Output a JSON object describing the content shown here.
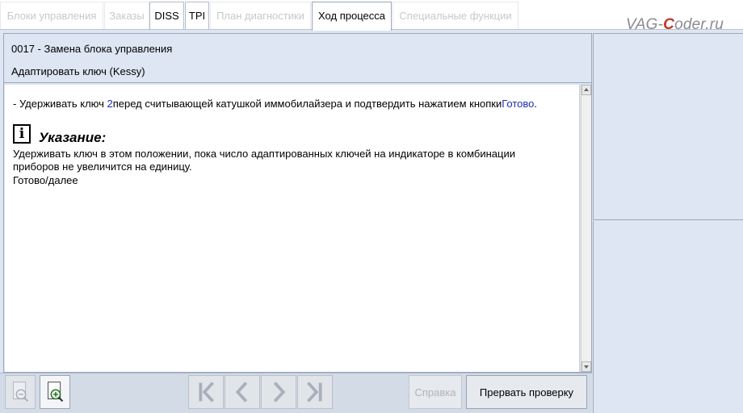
{
  "tabs": [
    {
      "label": "Блоки управления",
      "state": "disabled"
    },
    {
      "label": "Заказы",
      "state": "disabled"
    },
    {
      "label": "DISS",
      "state": "enabled"
    },
    {
      "label": "TPI",
      "state": "enabled"
    },
    {
      "label": "План диагностики",
      "state": "disabled"
    },
    {
      "label": "Ход процесса",
      "state": "active"
    },
    {
      "label": "Специальные функции",
      "state": "disabled"
    }
  ],
  "watermark": {
    "prefix": "VAG-",
    "highlight": "C",
    "suffix": "oder.ru"
  },
  "header": {
    "line1": "0017 - Замена блока управления",
    "line2": "Адаптировать ключ (Kessy)"
  },
  "content": {
    "instruction_prefix": "- Удерживать ключ ",
    "instruction_key_number": "2",
    "instruction_middle": "перед считывающей катушкой иммобилайзера и подтвердить нажатием кнопки",
    "instruction_button_ref": "Готово",
    "instruction_end": ".",
    "note_icon_glyph": "i",
    "note_title": "Указание:",
    "note_text": "Удерживать ключ в этом положении, пока число адаптированных ключей на индикаторе в комбинации приборов не увеличится на единицу.",
    "next_text": "Готово/далее"
  },
  "toolbar": {
    "zoom_out_icon": "zoom-out-icon",
    "zoom_in_icon": "zoom-in-icon",
    "nav_icons": [
      "first-icon",
      "previous-icon",
      "next-icon",
      "last-icon"
    ],
    "help_label": "Справка",
    "abort_label": "Прервать проверку"
  },
  "colors": {
    "panel_bg": "#dde6f2",
    "link_blue": "#1b2fb4",
    "watermark_red": "#c0392b"
  }
}
